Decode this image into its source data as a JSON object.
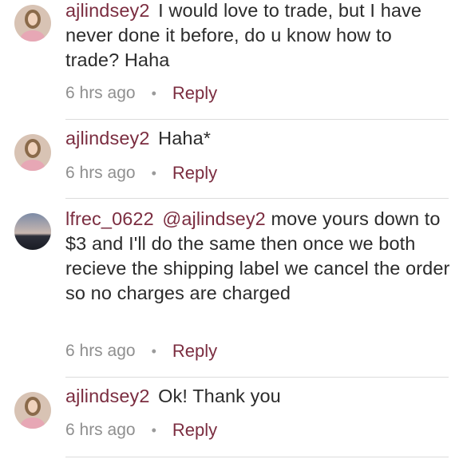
{
  "comments": [
    {
      "username": "ajlindsey2",
      "mention": "",
      "text": "I would love to trade, but I have never done it before, do u know how to trade? Haha",
      "time": "6 hrs ago",
      "reply_label": "Reply"
    },
    {
      "username": "ajlindsey2",
      "mention": "",
      "text": "Haha*",
      "time": "6 hrs ago",
      "reply_label": "Reply"
    },
    {
      "username": "lfrec_0622",
      "mention": "@ajlindsey2",
      "text": "move yours down to $3 and I'll do the same then once we both recieve the shipping label we cancel the order so no charges are charged",
      "time": "6 hrs ago",
      "reply_label": "Reply"
    },
    {
      "username": "ajlindsey2",
      "mention": "",
      "text": "Ok! Thank you",
      "time": "6 hrs ago",
      "reply_label": "Reply"
    }
  ],
  "separator": "•",
  "colors": {
    "username": "#7b2d40",
    "text": "#2b2b2b",
    "meta": "#8f8f8f",
    "divider": "#dcdcdc"
  }
}
